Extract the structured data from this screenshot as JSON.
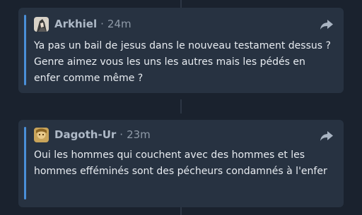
{
  "posts": [
    {
      "author": "Arkhiel",
      "separator": "·",
      "time": "24m",
      "avatar_icon": "anime-character-avatar",
      "text": "Ya pas un bail de jesus dans le nouveau testament dessus ? Genre aimez vous les uns les autres mais les pédés en enfer comme même ?"
    },
    {
      "author": "Dagoth-Ur",
      "separator": "·",
      "time": "23m",
      "avatar_icon": "character-portrait-avatar",
      "text": "Oui les hommes qui couchent avec des hommes et les hommes efféminés sont des pécheurs condamnés à l'enfer"
    }
  ],
  "colors": {
    "background": "#1a222e",
    "card": "#273241",
    "quote_accent": "#4a8fd8",
    "author_text": "#aeb9c7",
    "body_text": "#e8ecf1"
  }
}
